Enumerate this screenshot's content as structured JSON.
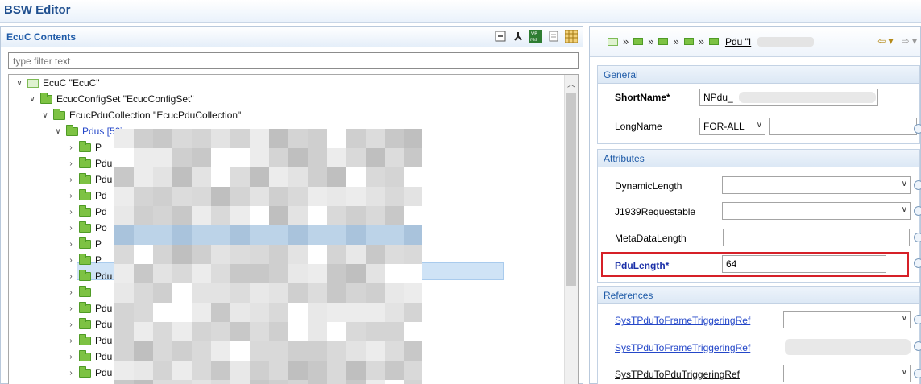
{
  "window": {
    "title": "BSW Editor"
  },
  "left_panel": {
    "title": "EcuC Contents",
    "filter_placeholder": "type filter text",
    "tree": [
      {
        "label": "EcuC \"EcuC\"",
        "icon": "ecu-icon",
        "expanded": true
      },
      {
        "label": "EcucConfigSet \"EcucConfigSet\"",
        "icon": "folder-icon",
        "expanded": true
      },
      {
        "label": "EcucPduCollection \"EcucPduCollection\"",
        "icon": "folder-icon",
        "expanded": true
      },
      {
        "label": "Pdus [59]",
        "icon": "folder-icon",
        "expanded": true
      },
      {
        "label": "P",
        "icon": "folder-icon"
      },
      {
        "label": "Pdu",
        "icon": "folder-icon"
      },
      {
        "label": "Pdu",
        "icon": "folder-icon"
      },
      {
        "label": "Pd",
        "icon": "folder-icon"
      },
      {
        "label": "Pd",
        "icon": "folder-icon"
      },
      {
        "label": "Po",
        "icon": "folder-icon"
      },
      {
        "label": "P",
        "icon": "folder-icon"
      },
      {
        "label": "P",
        "icon": "folder-icon"
      },
      {
        "label": "Pdu",
        "icon": "folder-icon"
      },
      {
        "label": "",
        "icon": "folder-icon"
      },
      {
        "label": "Pdu \"S",
        "icon": "folder-icon"
      },
      {
        "label": "Pdu \"",
        "icon": "folder-icon"
      },
      {
        "label": "Pdu \"V",
        "icon": "folder-icon"
      },
      {
        "label": "Pdu \"",
        "icon": "folder-icon"
      },
      {
        "label": "Pdu",
        "icon": "folder-icon"
      }
    ]
  },
  "right_panel": {
    "breadcrumb_label": "Pdu \"I",
    "general": {
      "header": "General",
      "shortname_label": "ShortName*",
      "shortname_value": "NPdu_",
      "longname_label": "LongName",
      "longname_lang": "FOR-ALL"
    },
    "attributes": {
      "header": "Attributes",
      "dynamic_length_label": "DynamicLength",
      "j1939_label": "J1939Requestable",
      "metadata_label": "MetaDataLength",
      "pdulength_label": "PduLength*",
      "pdulength_value": "64"
    },
    "references": {
      "header": "References",
      "ref1_label": "SysTPduToFrameTriggeringRef",
      "ref2_label": "SysTPduToFrameTriggeringRef",
      "ref3_label": "SysTPduToPduTriggeringRef"
    }
  },
  "colors": {
    "accent": "#1f5ba8",
    "highlight": "#d62028",
    "folder": "#7dc243"
  }
}
